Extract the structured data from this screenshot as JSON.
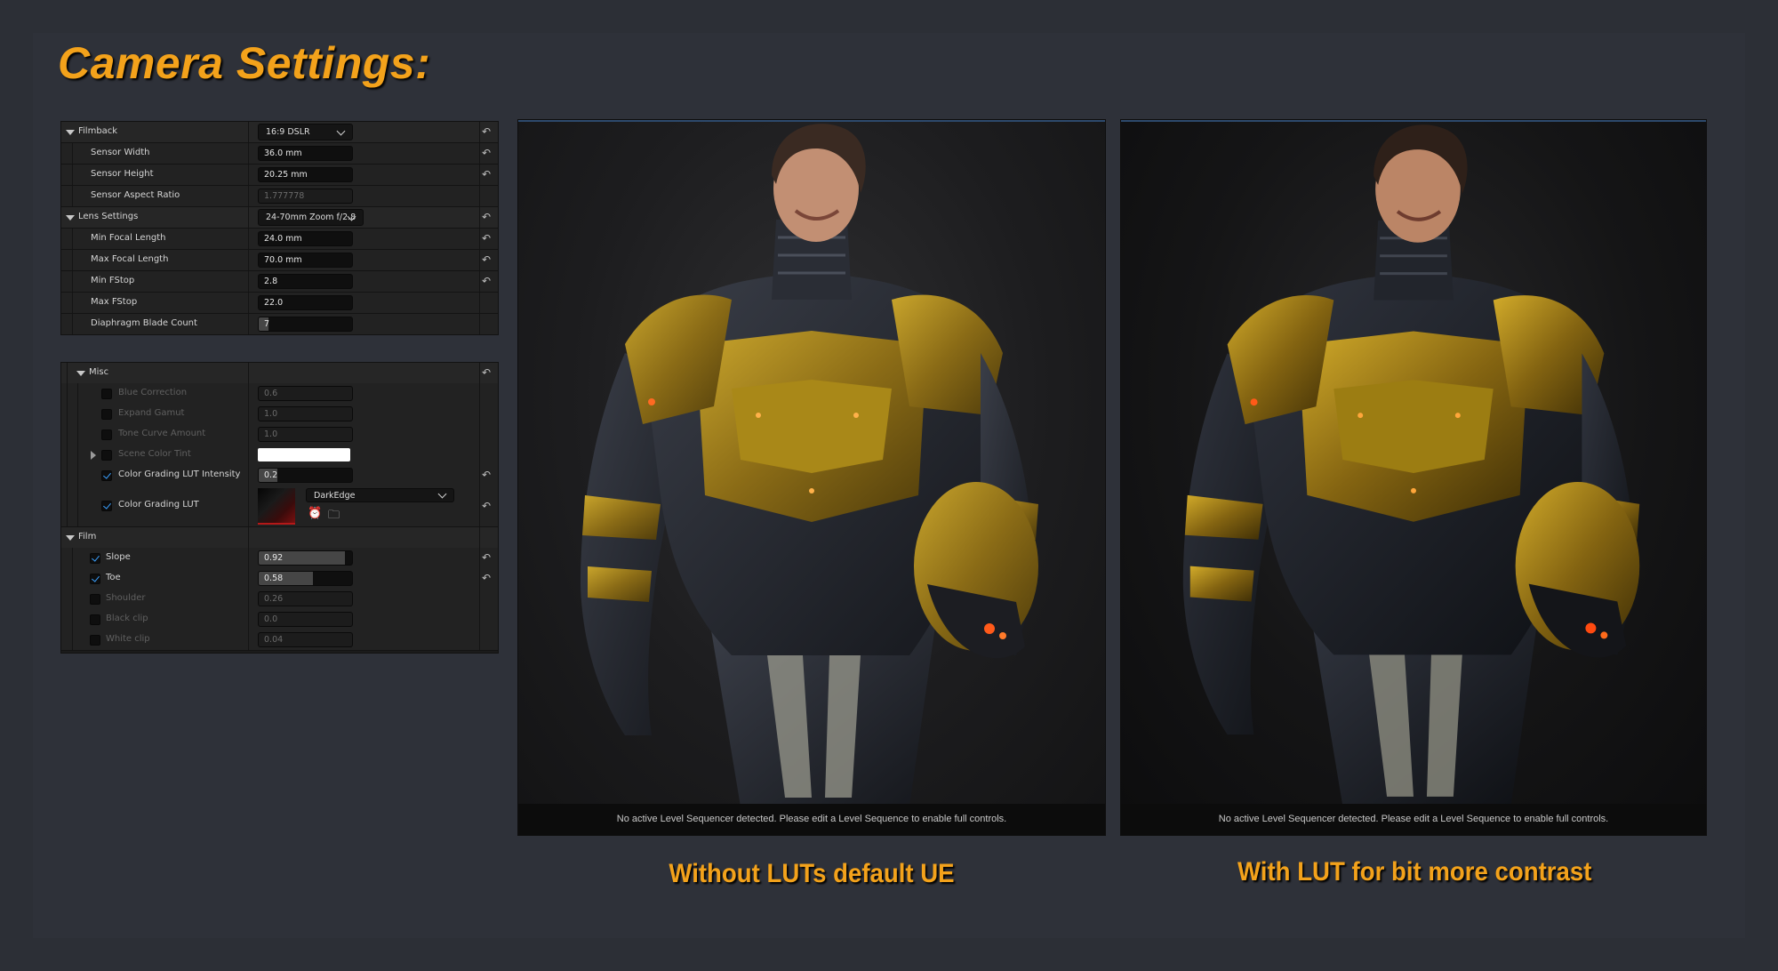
{
  "headline": "Camera Settings:",
  "camera_panel": {
    "filmback": {
      "label": "Filmback",
      "value": "16:9 DSLR",
      "sensor_width": {
        "label": "Sensor Width",
        "value": "36.0 mm"
      },
      "sensor_height": {
        "label": "Sensor Height",
        "value": "20.25 mm"
      },
      "sensor_aspect": {
        "label": "Sensor Aspect Ratio",
        "value": "1.777778"
      }
    },
    "lens": {
      "label": "Lens Settings",
      "value": "24-70mm Zoom f/2.8",
      "min_focal": {
        "label": "Min Focal Length",
        "value": "24.0 mm"
      },
      "max_focal": {
        "label": "Max Focal Length",
        "value": "70.0 mm"
      },
      "min_fstop": {
        "label": "Min FStop",
        "value": "2.8"
      },
      "max_fstop": {
        "label": "Max FStop",
        "value": "22.0"
      },
      "blade_count": {
        "label": "Diaphragm Blade Count",
        "value": "7",
        "fill_fraction": 0.1
      }
    }
  },
  "post_panel": {
    "misc": {
      "label": "Misc",
      "blue_correction": {
        "label": "Blue Correction",
        "value": "0.6",
        "enabled": false
      },
      "expand_gamut": {
        "label": "Expand Gamut",
        "value": "1.0",
        "enabled": false
      },
      "tone_curve": {
        "label": "Tone Curve Amount",
        "value": "1.0",
        "enabled": false
      },
      "scene_tint": {
        "label": "Scene Color Tint",
        "enabled": false,
        "color": "#ffffff"
      },
      "lut_intensity": {
        "label": "Color Grading LUT Intensity",
        "value": "0.2",
        "enabled": true,
        "fill_fraction": 0.2
      },
      "lut": {
        "label": "Color Grading LUT",
        "value": "DarkEdge",
        "enabled": true
      }
    },
    "film": {
      "label": "Film",
      "slope": {
        "label": "Slope",
        "value": "0.92",
        "enabled": true,
        "fill_fraction": 0.92
      },
      "toe": {
        "label": "Toe",
        "value": "0.58",
        "enabled": true,
        "fill_fraction": 0.58
      },
      "shoulder": {
        "label": "Shoulder",
        "value": "0.26",
        "enabled": false
      },
      "black_clip": {
        "label": "Black clip",
        "value": "0.0",
        "enabled": false
      },
      "white_clip": {
        "label": "White clip",
        "value": "0.04",
        "enabled": false
      }
    }
  },
  "viewports": [
    {
      "status": "No active Level Sequencer detected. Please edit a Level Sequence to enable full controls.",
      "caption": "Without LUTs default UE"
    },
    {
      "status": "No active Level Sequencer detected. Please edit a Level Sequence to enable full controls.",
      "caption": "With LUT for bit more contrast"
    }
  ],
  "colors": {
    "accent": "#f3a21b",
    "checkbox": "#3aa0ff",
    "armor_gold": "#a8871f",
    "armor_dark": "#23262e"
  },
  "icons": [
    "reset-arrow-icon",
    "expand-arrow-icon",
    "chevron-down-icon",
    "checkbox-icon",
    "browse-asset-icon",
    "find-in-content-icon",
    "lut-thumbnail-icon"
  ]
}
